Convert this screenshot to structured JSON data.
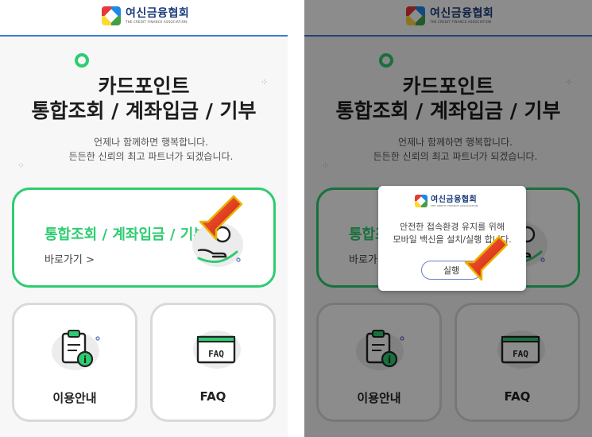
{
  "brand": {
    "name": "여신금융협회",
    "sub": "THE CREDIT FINANCE ASSOCIATION"
  },
  "hero": {
    "title_line1": "카드포인트",
    "title_line2": "통합조회 / 계좌입금 / 기부",
    "subtitle_line1": "언제나 함께하면 행복합니다.",
    "subtitle_line2": "든든한 신뢰의 최고 파트너가 되겠습니다."
  },
  "main_card": {
    "label": "통합조회 / 계좌입금 / 기부",
    "link": "바로가기 >"
  },
  "tiles": [
    {
      "label": "이용안내",
      "icon": "clipboard-info-icon"
    },
    {
      "label": "FAQ",
      "icon": "faq-window-icon",
      "icon_text": "FAQ"
    }
  ],
  "dialog": {
    "message_line1": "안전한 접속환경 유지를 위해",
    "message_line2": "모바일 백신을 설치/실행 합니다.",
    "button_label": "실행"
  },
  "colors": {
    "accent_green": "#2ecc71",
    "brand_navy": "#1a3b7a",
    "header_line": "#3a7fd5",
    "arrow_red": "#e0311a"
  },
  "decorations": {
    "sparkle": "⁘"
  }
}
